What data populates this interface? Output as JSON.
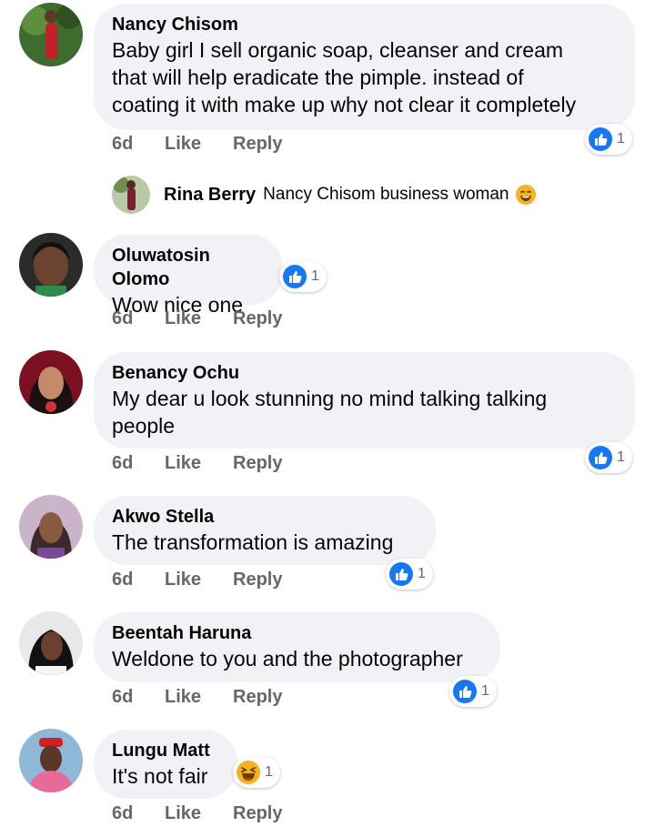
{
  "colors": {
    "bubble": "#f0f2f5",
    "meta": "#65676b",
    "like_blue": "#1877f2",
    "haha_yellow": "#f7b125"
  },
  "comments": [
    {
      "author": "Nancy Chisom",
      "lines": [
        "Baby girl I sell organic soap, cleanser and cream",
        "that will help eradicate the pimple. instead of",
        "coating it with make up why not clear it completely"
      ],
      "time": "6d",
      "like": "Like",
      "reply": "Reply",
      "reaction_icon": "like-icon",
      "reaction_count": "1"
    },
    {
      "author": "Oluwatosin Olomo",
      "lines": [
        "Wow nice one"
      ],
      "time": "6d",
      "like": "Like",
      "reply": "Reply",
      "reaction_icon": "like-icon",
      "reaction_count": "1"
    },
    {
      "author": "Benancy Ochu",
      "lines": [
        "My dear u look stunning no mind talking talking",
        "people"
      ],
      "time": "6d",
      "like": "Like",
      "reply": "Reply",
      "reaction_icon": "like-icon",
      "reaction_count": "1"
    },
    {
      "author": "Akwo Stella",
      "lines": [
        "The transformation is amazing"
      ],
      "time": "6d",
      "like": "Like",
      "reply": "Reply",
      "reaction_icon": "like-icon",
      "reaction_count": "1"
    },
    {
      "author": "Beentah Haruna",
      "lines": [
        "Weldone to you and the photographer"
      ],
      "time": "6d",
      "like": "Like",
      "reply": "Reply",
      "reaction_icon": "like-icon",
      "reaction_count": "1"
    },
    {
      "author": "Lungu Matt",
      "lines": [
        "It's not fair"
      ],
      "time": "6d",
      "like": "Like",
      "reply": "Reply",
      "reaction_icon": "haha-icon",
      "reaction_count": "1"
    }
  ],
  "reply_preview": {
    "author": "Rina Berry",
    "text": "Nancy Chisom  business woman",
    "emoji": "grinning-face-icon"
  }
}
